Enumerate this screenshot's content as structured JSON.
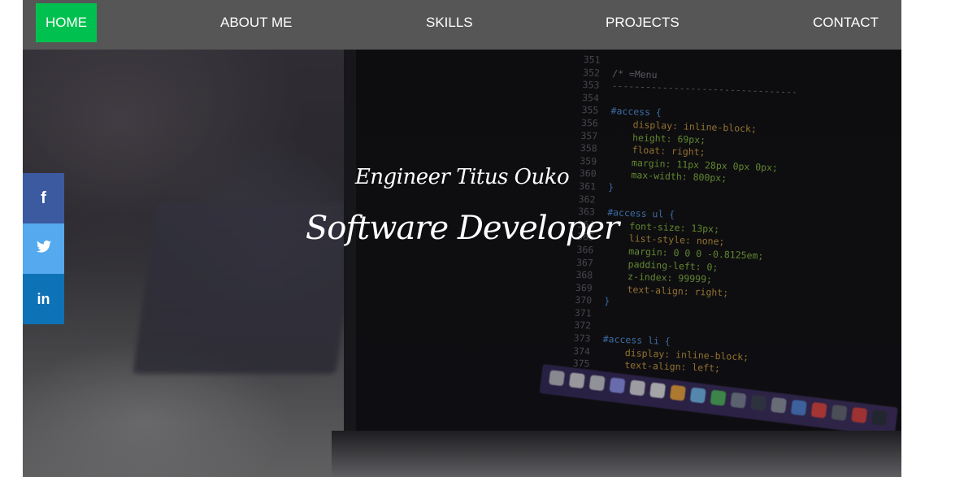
{
  "nav": {
    "items": [
      {
        "label": "HOME",
        "active": true
      },
      {
        "label": "ABOUT ME"
      },
      {
        "label": "SKILLS"
      },
      {
        "label": "PROJECTS"
      },
      {
        "label": "CONTACT"
      }
    ],
    "active_color": "#00c14f",
    "background": "#565656"
  },
  "hero": {
    "subtitle": "Engineer Titus Ouko",
    "title": "Software Developer"
  },
  "social": {
    "items": [
      {
        "name": "facebook",
        "icon": "facebook-icon",
        "glyph": "f",
        "color": "#3b5aa0"
      },
      {
        "name": "twitter",
        "icon": "twitter-icon",
        "color": "#55a9ee"
      },
      {
        "name": "linkedin",
        "icon": "linkedin-icon",
        "glyph": "in",
        "color": "#0e72b6"
      }
    ]
  },
  "code_lines": [
    {
      "n": "351",
      "t": ""
    },
    {
      "n": "352",
      "t": "/* =Menu"
    },
    {
      "n": "353",
      "t": "---------------------------------"
    },
    {
      "n": "354",
      "t": ""
    },
    {
      "n": "355",
      "t": "#access {"
    },
    {
      "n": "356",
      "t": "    display: inline-block;"
    },
    {
      "n": "357",
      "t": "    height: 69px;"
    },
    {
      "n": "358",
      "t": "    float: right;"
    },
    {
      "n": "359",
      "t": "    margin: 11px 28px 0px 0px;"
    },
    {
      "n": "360",
      "t": "    max-width: 800px;"
    },
    {
      "n": "361",
      "t": "}"
    },
    {
      "n": "362",
      "t": ""
    },
    {
      "n": "363",
      "t": "#access ul {"
    },
    {
      "n": "364",
      "t": "    font-size: 13px;"
    },
    {
      "n": "365",
      "t": "    list-style: none;"
    },
    {
      "n": "366",
      "t": "    margin: 0 0 0 -0.8125em;"
    },
    {
      "n": "367",
      "t": "    padding-left: 0;"
    },
    {
      "n": "368",
      "t": "    z-index: 99999;"
    },
    {
      "n": "369",
      "t": "    text-align: right;"
    },
    {
      "n": "370",
      "t": "}"
    },
    {
      "n": "371",
      "t": ""
    },
    {
      "n": "372",
      "t": ""
    },
    {
      "n": "373",
      "t": "#access li {"
    },
    {
      "n": "374",
      "t": "    display: inline-block;"
    },
    {
      "n": "375",
      "t": "    text-align: left;"
    }
  ]
}
